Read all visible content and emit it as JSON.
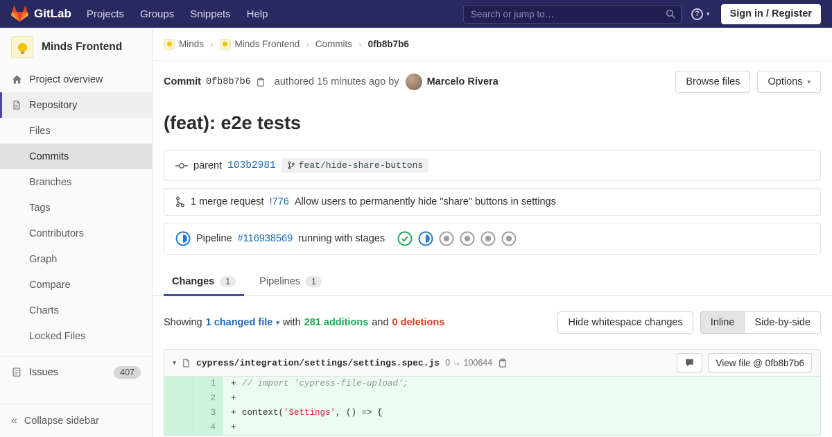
{
  "navbar": {
    "brand": "GitLab",
    "menu": [
      "Projects",
      "Groups",
      "Snippets",
      "Help"
    ],
    "search_placeholder": "Search or jump to…",
    "signin": "Sign in / Register"
  },
  "icons": {
    "help": "?",
    "chevron_down": "▾",
    "dropdown_caret": "▾",
    "breadcrumb_separator": "›",
    "collapse_sidebar": "«"
  },
  "sidebar": {
    "project_name": "Minds Frontend",
    "overview": "Project overview",
    "repository": "Repository",
    "repo_items": [
      "Files",
      "Commits",
      "Branches",
      "Tags",
      "Contributors",
      "Graph",
      "Compare",
      "Charts",
      "Locked Files"
    ],
    "active_item": "Commits",
    "issues": "Issues",
    "issues_count": "407",
    "collapse": "Collapse sidebar"
  },
  "breadcrumb": {
    "items": [
      "Minds",
      "Minds Frontend",
      "Commits",
      "0fb8b7b6"
    ]
  },
  "commit": {
    "label": "Commit",
    "sha": "0fb8b7b6",
    "authored": "authored 15 minutes ago by",
    "author": "Marcelo Rivera",
    "browse_files": "Browse files",
    "options": "Options",
    "title": "(feat): e2e tests"
  },
  "refs": {
    "parent_label": "parent",
    "parent_sha": "103b2981",
    "branch": "feat/hide-share-buttons"
  },
  "merge_request": {
    "count_label": "1 merge request",
    "ref": "!776",
    "title": "Allow users to permanently hide \"share\" buttons in settings"
  },
  "pipeline": {
    "label": "Pipeline",
    "id": "#116938569",
    "status_text": "running with stages",
    "stages": [
      "success",
      "running",
      "created",
      "created",
      "created",
      "created"
    ]
  },
  "tabs": {
    "changes": "Changes",
    "changes_count": "1",
    "pipelines": "Pipelines",
    "pipelines_count": "1"
  },
  "toolbar": {
    "showing": "Showing",
    "changed_files": "1 changed file",
    "with": "with",
    "additions": "281 additions",
    "and": "and",
    "deletions": "0 deletions",
    "hide_whitespace": "Hide whitespace changes",
    "inline": "Inline",
    "side_by_side": "Side-by-side"
  },
  "file": {
    "path": "cypress/integration/settings/settings.spec.js",
    "mode": "0 → 100644",
    "view_file": "View file @ 0fb8b7b6"
  },
  "diff": {
    "lines": [
      {
        "new_ln": "1",
        "sign": "+",
        "comment": "// import 'cypress-file-upload';"
      },
      {
        "new_ln": "2",
        "sign": "+"
      },
      {
        "new_ln": "3",
        "sign": "+",
        "code_pre": "context(",
        "code_str": "'Settings'",
        "code_post": ", () => {"
      },
      {
        "new_ln": "4",
        "sign": "+"
      }
    ]
  },
  "colors": {
    "navbar_bg": "#292961",
    "link": "#1b69b6",
    "addition_green": "#1aaa55",
    "deletion_red": "#db3b21",
    "running_blue": "#1f78d1",
    "active_indigo": "#4b4ba3"
  }
}
